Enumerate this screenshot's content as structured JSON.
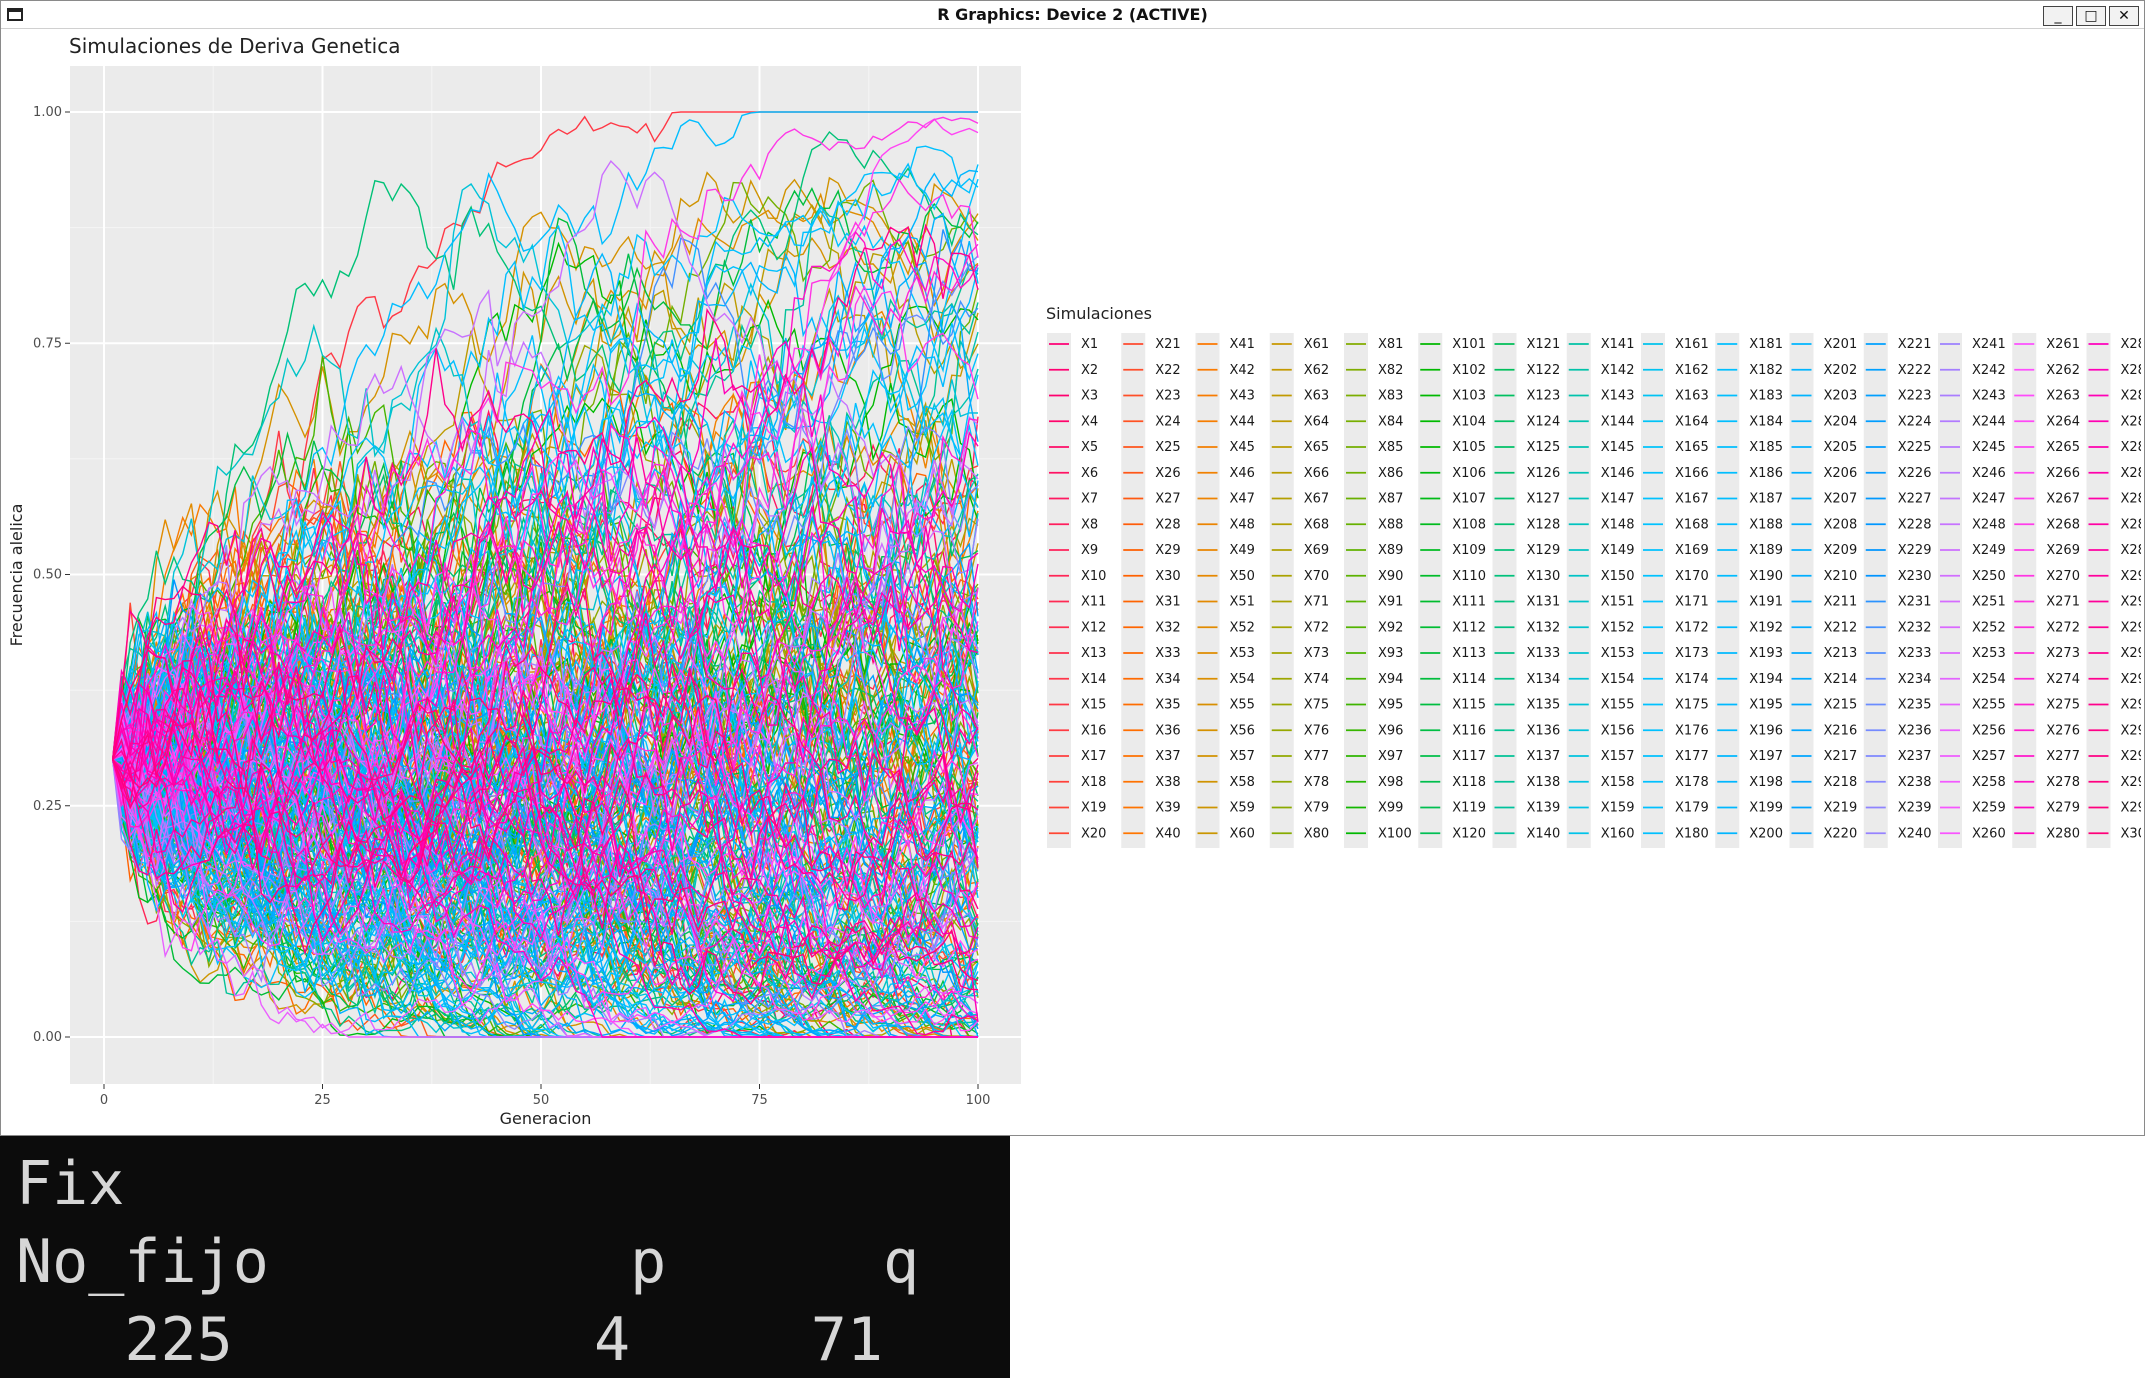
{
  "window": {
    "title": "R Graphics: Device 2 (ACTIVE)",
    "buttons": {
      "minimize": "_",
      "maximize": "□",
      "close": "✕"
    }
  },
  "chart_data": {
    "type": "line",
    "title": "Simulaciones de Deriva Genetica",
    "xlabel": "Generacion",
    "ylabel": "Frecuencia alelica",
    "xlim": [
      0,
      100
    ],
    "ylim": [
      0,
      1
    ],
    "x_ticks": [
      0,
      25,
      50,
      75,
      100
    ],
    "y_ticks": [
      0.0,
      0.25,
      0.5,
      0.75,
      1.0
    ],
    "x_tick_labels": [
      "0",
      "25",
      "50",
      "75",
      "100"
    ],
    "y_tick_labels": [
      "0.00",
      "0.25",
      "0.50",
      "0.75",
      "1.00"
    ],
    "initial_frequency": 0.3,
    "n_series": 300,
    "generations": 100,
    "grid": true,
    "background": "#ebebeb",
    "legend_title": "Simulaciones",
    "legend_placement": "right",
    "series_name_prefix": "X",
    "note_series_values": "300 simulated allele-frequency trajectories; individual values not legible"
  },
  "console": {
    "lines": [
      "Fix",
      "No_fijo          p      q",
      "   225          4     71"
    ]
  }
}
